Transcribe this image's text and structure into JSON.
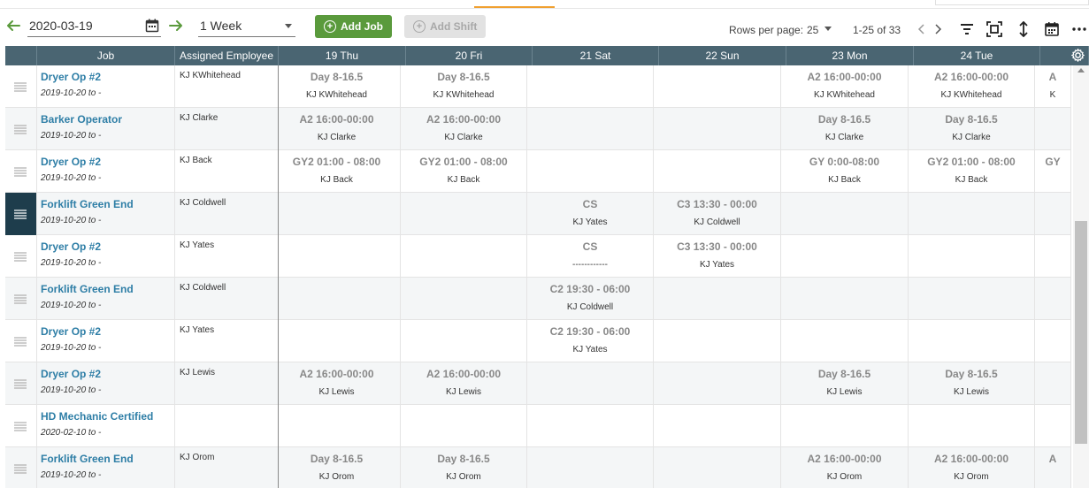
{
  "toolbar": {
    "date_value": "2020-03-19",
    "period_value": "1 Week",
    "add_job_label": "Add Job",
    "add_shift_label": "Add Shift",
    "rows_per_page_label": "Rows per page:",
    "rows_per_page_value": "25",
    "range_text": "1-25 of 33",
    "accent_color": "#5a9a3c"
  },
  "columns": {
    "job": "Job",
    "employee": "Assigned Employee",
    "days": [
      "19 Thu",
      "20 Fri",
      "21 Sat",
      "22 Sun",
      "23 Mon",
      "24 Tue",
      ""
    ]
  },
  "rows": [
    {
      "job": "Dryer Op #2",
      "dates": "2019-10-20  to  -",
      "employee": "KJ KWhitehead",
      "active": false,
      "shifts": [
        [
          "Day 8-16.5",
          "KJ KWhitehead"
        ],
        [
          "Day 8-16.5",
          "KJ KWhitehead"
        ],
        [
          "",
          ""
        ],
        [
          "",
          ""
        ],
        [
          "A2 16:00-00:00",
          "KJ KWhitehead"
        ],
        [
          "A2 16:00-00:00",
          "KJ KWhitehead"
        ],
        [
          "A",
          "K"
        ]
      ]
    },
    {
      "job": "Barker Operator",
      "dates": "2019-10-20  to  -",
      "employee": "KJ Clarke",
      "active": false,
      "shifts": [
        [
          "A2 16:00-00:00",
          "KJ Clarke"
        ],
        [
          "A2 16:00-00:00",
          "KJ Clarke"
        ],
        [
          "",
          ""
        ],
        [
          "",
          ""
        ],
        [
          "Day 8-16.5",
          "KJ Clarke"
        ],
        [
          "Day 8-16.5",
          "KJ Clarke"
        ],
        [
          "",
          ""
        ]
      ]
    },
    {
      "job": "Dryer Op #2",
      "dates": "2019-10-20  to  -",
      "employee": "KJ Back",
      "active": false,
      "shifts": [
        [
          "GY2 01:00 - 08:00",
          "KJ Back"
        ],
        [
          "GY2 01:00 - 08:00",
          "KJ Back"
        ],
        [
          "",
          ""
        ],
        [
          "",
          ""
        ],
        [
          "GY 0:00-08:00",
          "KJ Back"
        ],
        [
          "GY2 01:00 - 08:00",
          "KJ Back"
        ],
        [
          "GY",
          ""
        ]
      ]
    },
    {
      "job": "Forklift Green End",
      "dates": "2019-10-20  to  -",
      "employee": "KJ Coldwell",
      "active": true,
      "shifts": [
        [
          "",
          ""
        ],
        [
          "",
          ""
        ],
        [
          "CS",
          "KJ Yates"
        ],
        [
          "C3 13:30 - 00:00",
          "KJ Coldwell"
        ],
        [
          "",
          ""
        ],
        [
          "",
          ""
        ],
        [
          "",
          ""
        ]
      ]
    },
    {
      "job": "Dryer Op #2",
      "dates": "2019-10-20  to  -",
      "employee": "KJ Yates",
      "active": false,
      "shifts": [
        [
          "",
          ""
        ],
        [
          "",
          ""
        ],
        [
          "CS",
          "------------"
        ],
        [
          "C3 13:30 - 00:00",
          "KJ Yates"
        ],
        [
          "",
          ""
        ],
        [
          "",
          ""
        ],
        [
          "",
          ""
        ]
      ]
    },
    {
      "job": "Forklift Green End",
      "dates": "2019-10-20  to  -",
      "employee": "KJ Coldwell",
      "active": false,
      "shifts": [
        [
          "",
          ""
        ],
        [
          "",
          ""
        ],
        [
          "C2 19:30 - 06:00",
          "KJ Coldwell"
        ],
        [
          "",
          ""
        ],
        [
          "",
          ""
        ],
        [
          "",
          ""
        ],
        [
          "",
          ""
        ]
      ]
    },
    {
      "job": "Dryer Op #2",
      "dates": "2019-10-20  to  -",
      "employee": "KJ Yates",
      "active": false,
      "shifts": [
        [
          "",
          ""
        ],
        [
          "",
          ""
        ],
        [
          "C2 19:30 - 06:00",
          "KJ Yates"
        ],
        [
          "",
          ""
        ],
        [
          "",
          ""
        ],
        [
          "",
          ""
        ],
        [
          "",
          ""
        ]
      ]
    },
    {
      "job": "Dryer Op #2",
      "dates": "2019-10-20  to  -",
      "employee": "KJ Lewis",
      "active": false,
      "shifts": [
        [
          "A2 16:00-00:00",
          "KJ Lewis"
        ],
        [
          "A2 16:00-00:00",
          "KJ Lewis"
        ],
        [
          "",
          ""
        ],
        [
          "",
          ""
        ],
        [
          "Day 8-16.5",
          "KJ Lewis"
        ],
        [
          "Day 8-16.5",
          "KJ Lewis"
        ],
        [
          "",
          ""
        ]
      ]
    },
    {
      "job": "HD Mechanic Certified",
      "dates": "2020-02-10  to  -",
      "employee": "",
      "active": false,
      "shifts": [
        [
          "",
          ""
        ],
        [
          "",
          ""
        ],
        [
          "",
          ""
        ],
        [
          "",
          ""
        ],
        [
          "",
          ""
        ],
        [
          "",
          ""
        ],
        [
          "",
          ""
        ]
      ]
    },
    {
      "job": "Forklift Green End",
      "dates": "2019-10-20  to  -",
      "employee": "KJ Orom",
      "active": false,
      "shifts": [
        [
          "Day 8-16.5",
          "KJ Orom"
        ],
        [
          "Day 8-16.5",
          "KJ Orom"
        ],
        [
          "",
          ""
        ],
        [
          "",
          ""
        ],
        [
          "A2 16:00-00:00",
          "KJ Orom"
        ],
        [
          "A2 16:00-00:00",
          "KJ Orom"
        ],
        [
          "A",
          ""
        ]
      ]
    }
  ]
}
